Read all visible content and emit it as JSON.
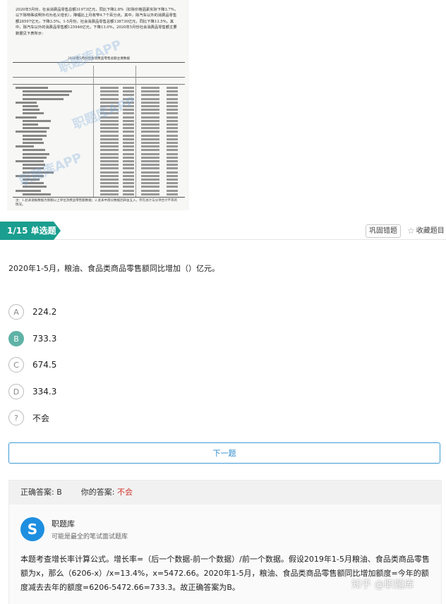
{
  "scan": {
    "paragraph": "2020年5月份，社会消费品零售总额31973亿元，同比下降2.8%（扣除价格因素实际下降3.7%，以下除特殊说明外均为名义增长），降幅比上月收窄4.7个百分点。其中，除汽车以外的消费品零售额28597亿元，下降3.5%。1-5月份，社会消费品零售总额138730亿元，同比下降13.5%。其中，除汽车以外的消费品零售额125946亿元，下降13.0%。2020年5月份社会消费品零售额主要数据见下表所示：",
    "caption": "2020年5月份社会消费品零售总额主要数据",
    "footnote": "注：1.此表速报数据为限额以上单位消费品零售额数据；2.此表中部分数据因四舍五入，存在总计与分项合计不等的情况。",
    "watermark": "职题库APP"
  },
  "question_bar": {
    "tag": "1/15 单选题",
    "review_label": "巩固错题",
    "favorite_label": "收藏题目",
    "favorite_icon": "star-outline-icon"
  },
  "question": {
    "text": "2020年1-5月，粮油、食品类商品零售额同比增加（）亿元。",
    "options": [
      {
        "letter": "A",
        "text": "224.2",
        "selected": false
      },
      {
        "letter": "B",
        "text": "733.3",
        "selected": true
      },
      {
        "letter": "C",
        "text": "674.5",
        "selected": false
      },
      {
        "letter": "D",
        "text": "334.3",
        "selected": false
      },
      {
        "letter": "?",
        "text": "不会",
        "selected": false
      }
    ],
    "selected_color": "#5fb3a6"
  },
  "next_button": "下一题",
  "answer": {
    "correct_label": "正确答案:",
    "correct_value": "B",
    "yours_label": "你的答案:",
    "yours_value": "不会",
    "brand_name": "职题库",
    "brand_sub": "可能是最全的笔试面试题库",
    "explanation": "本题考查增长率计算公式。增长率=（后一个数据-前一个数据）/前一个数据。假设2019年1-5月粮油、食品类商品零售额为x，那么（6206-x）/x=13.4%，x=5472.66。2020年1-5月，粮油、食品类商品零售额同比增加额度=今年的额度减去去年的额度=6206-5472.66=733.3。故正确答案为B。"
  },
  "zhihu_watermark": "知乎 @职题库",
  "colors": {
    "accent": "#1a9e8f",
    "link": "#2f8ccc",
    "wrong": "#d0342c",
    "logo": "#1e8fe0"
  }
}
